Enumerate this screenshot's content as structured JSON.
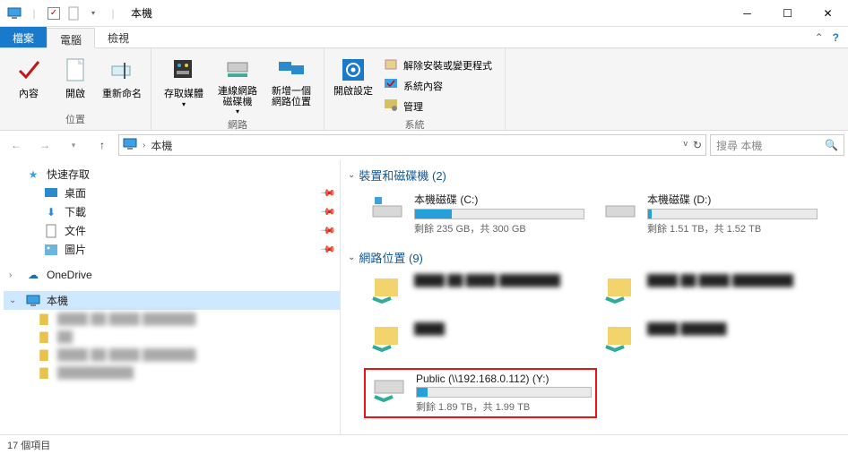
{
  "window": {
    "title": "本機",
    "minimize": "─",
    "maximize": "☐",
    "close": "✕"
  },
  "tabs": {
    "file": "檔案",
    "computer": "電腦",
    "view": "檢視"
  },
  "ribbon": {
    "location": {
      "properties": "內容",
      "open": "開啟",
      "rename": "重新命名",
      "group": "位置"
    },
    "network": {
      "media": "存取媒體",
      "connect_drive": "連線網路磁碟機",
      "add_location": "新增一個網路位置",
      "group": "網路"
    },
    "system": {
      "settings": "開啟設定",
      "uninstall": "解除安裝或變更程式",
      "sysprops": "系統內容",
      "manage": "管理",
      "group": "系統"
    }
  },
  "nav": {
    "crumb_root": "本機",
    "refresh": "↻"
  },
  "search": {
    "placeholder": "搜尋 本機"
  },
  "sidebar": {
    "quick": "快速存取",
    "desktop": "桌面",
    "downloads": "下載",
    "documents": "文件",
    "pictures": "圖片",
    "onedrive": "OneDrive",
    "thispc": "本機"
  },
  "content": {
    "devices_header": "裝置和磁碟機 (2)",
    "network_header": "網路位置 (9)",
    "drives": [
      {
        "name": "本機磁碟 (C:)",
        "stats": "剩餘 235 GB，共 300 GB",
        "fill": 22
      },
      {
        "name": "本機磁碟 (D:)",
        "stats": "剩餘 1.51 TB，共 1.52 TB",
        "fill": 2
      }
    ],
    "public": {
      "name": "Public (\\\\192.168.0.112) (Y:)",
      "stats": "剩餘 1.89 TB，共 1.99 TB",
      "fill": 6
    }
  },
  "status": {
    "count": "17 個項目"
  },
  "chart_data": {
    "type": "bar",
    "title": "Drive usage",
    "series": [
      {
        "name": "本機磁碟 (C:)",
        "free_gb": 235,
        "total_gb": 300
      },
      {
        "name": "本機磁碟 (D:)",
        "free_tb": 1.51,
        "total_tb": 1.52
      },
      {
        "name": "Public (Y:)",
        "free_tb": 1.89,
        "total_tb": 1.99
      }
    ]
  }
}
